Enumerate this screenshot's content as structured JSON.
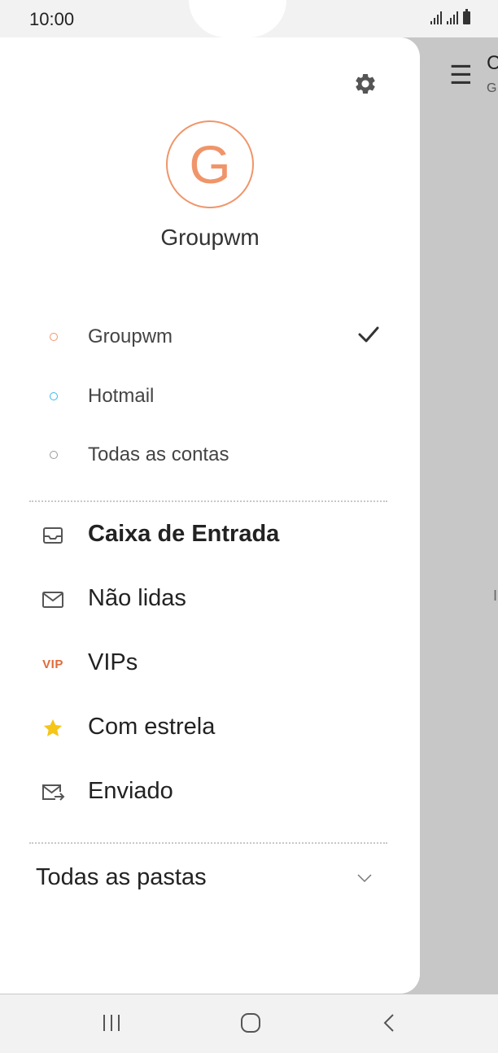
{
  "status_bar": {
    "time": "10:00"
  },
  "background_app": {
    "title_partial": "C",
    "subtitle_partial": "G",
    "middle_partial": "I"
  },
  "drawer": {
    "account_avatar_letter": "G",
    "account_name": "Groupwm",
    "accounts": [
      {
        "label": "Groupwm",
        "dot_color": "#f0956a",
        "selected": true
      },
      {
        "label": "Hotmail",
        "dot_color": "#3cb7e6",
        "selected": false
      },
      {
        "label": "Todas as contas",
        "dot_color": "#999999",
        "selected": false
      }
    ],
    "folders": [
      {
        "label": "Caixa de Entrada",
        "icon": "inbox-icon",
        "bold": true
      },
      {
        "label": "Não lidas",
        "icon": "mail-unread-icon",
        "bold": false
      },
      {
        "label": "VIPs",
        "icon": "vip-icon",
        "icon_text": "VIP",
        "bold": false
      },
      {
        "label": "Com estrela",
        "icon": "star-icon",
        "bold": false
      },
      {
        "label": "Enviado",
        "icon": "sent-mail-icon",
        "bold": false
      }
    ],
    "all_folders_label": "Todas as pastas"
  },
  "colors": {
    "accent_orange": "#f0956a",
    "hotmail_blue": "#3cb7e6",
    "vip_orange": "#e06a3a",
    "star_yellow": "#f5c518"
  }
}
